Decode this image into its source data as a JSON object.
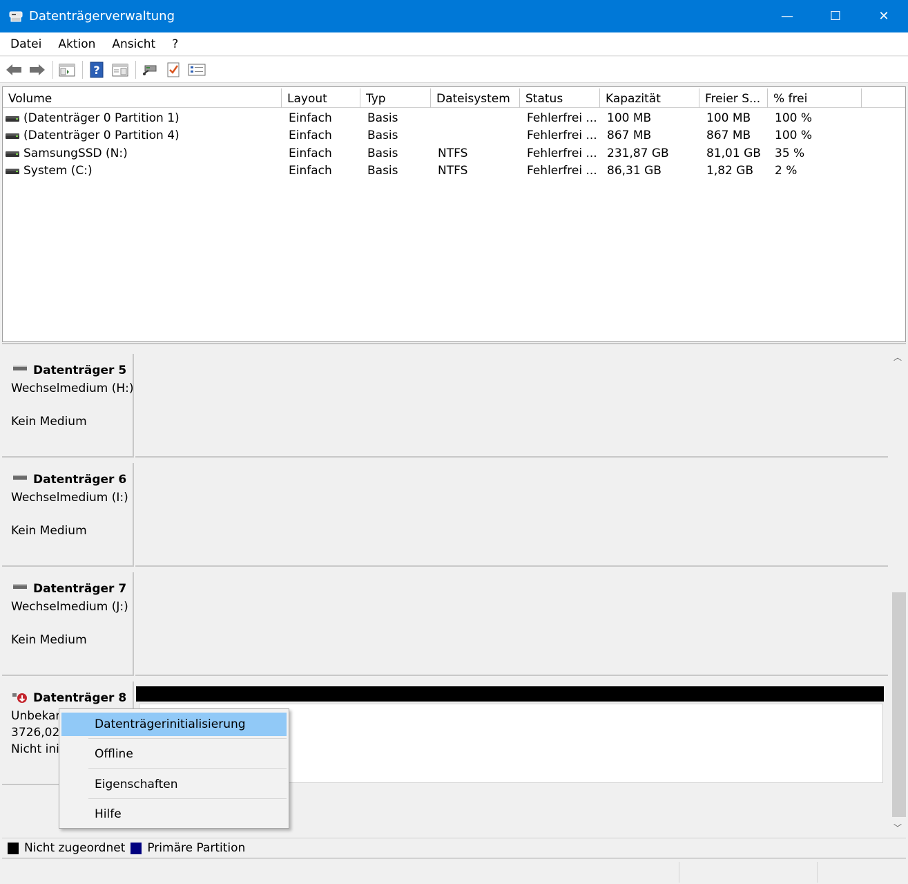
{
  "window": {
    "title": "Datenträgerverwaltung",
    "controls": {
      "minimize": "—",
      "maximize": "☐",
      "close": "✕"
    },
    "accent": "#0078d7"
  },
  "menu": [
    "Datei",
    "Aktion",
    "Ansicht",
    "?"
  ],
  "toolbar": [
    "back-icon",
    "forward-icon",
    "console-tree-icon",
    "help-icon",
    "details-icon",
    "connect-icon",
    "check-icon",
    "list-icon"
  ],
  "volume_table": {
    "headers": [
      "Volume",
      "Layout",
      "Typ",
      "Dateisystem",
      "Status",
      "Kapazität",
      "Freier S...",
      "% frei"
    ],
    "rows": [
      [
        "(Datenträger 0 Partition 1)",
        "Einfach",
        "Basis",
        "",
        "Fehlerfrei ...",
        "100 MB",
        "100 MB",
        "100 %"
      ],
      [
        "(Datenträger 0 Partition 4)",
        "Einfach",
        "Basis",
        "",
        "Fehlerfrei ...",
        "867 MB",
        "867 MB",
        "100 %"
      ],
      [
        "SamsungSSD (N:)",
        "Einfach",
        "Basis",
        "NTFS",
        "Fehlerfrei ...",
        "231,87 GB",
        "81,01 GB",
        "35 %"
      ],
      [
        "System (C:)",
        "Einfach",
        "Basis",
        "NTFS",
        "Fehlerfrei ...",
        "86,31 GB",
        "1,82 GB",
        "2 %"
      ]
    ]
  },
  "disks": [
    {
      "name": "Datenträger 5",
      "line1": "Wechselmedium  (H:)",
      "line2": "",
      "line3": "Kein Medium"
    },
    {
      "name": "Datenträger 6",
      "line1": "Wechselmedium  (I:)",
      "line2": "",
      "line3": "Kein Medium"
    },
    {
      "name": "Datenträger 7",
      "line1": "Wechselmedium  (J:)",
      "line2": "",
      "line3": "Kein Medium"
    },
    {
      "name": "Datenträger 8",
      "line1": "Unbekar",
      "line2": "3726,02",
      "line3": "Nicht ini"
    }
  ],
  "context_menu": [
    "Datenträgerinitialisierung",
    "Offline",
    "Eigenschaften",
    "Hilfe"
  ],
  "legend": [
    {
      "label": "Nicht zugeordnet",
      "color": "#000000"
    },
    {
      "label": "Primäre Partition",
      "color": "#00007f"
    }
  ],
  "highlight_color": "#91c9f7"
}
